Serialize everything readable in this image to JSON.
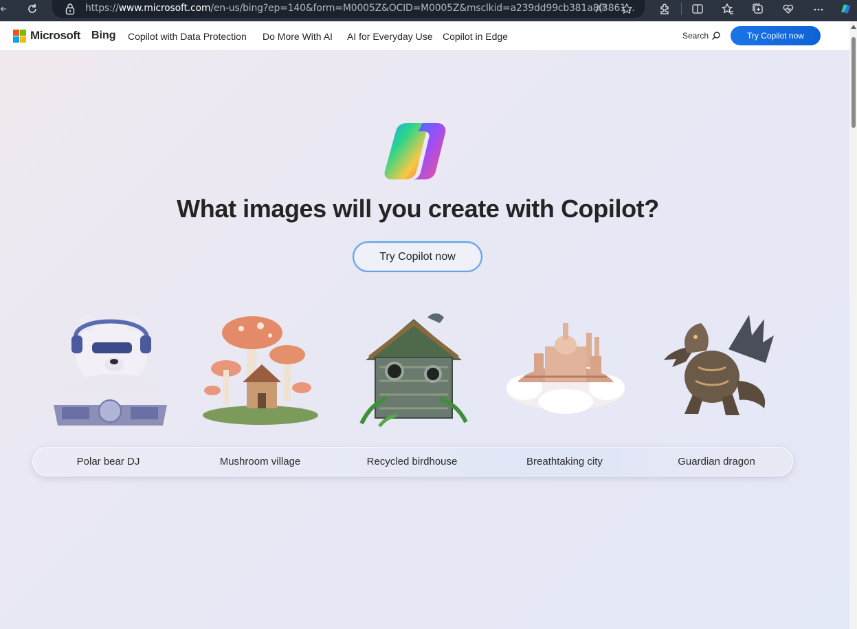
{
  "browser": {
    "url_prefix": "https://",
    "url_domain": "www.microsoft.com",
    "url_rest": "/en-us/bing?ep=140&form=M0005Z&OCID=M0005Z&msclkid=a239dd99cb381a8f3861...",
    "read_aloud_label": "A",
    "icons": [
      "back-icon",
      "refresh-icon",
      "lock-icon",
      "read-aloud-icon",
      "favorite-star-icon",
      "extensions-icon",
      "split-screen-icon",
      "favorites-icon",
      "collections-icon",
      "browser-essentials-icon",
      "more-icon",
      "copilot-icon"
    ]
  },
  "header": {
    "brand": "Microsoft",
    "nav": [
      {
        "label": "Bing"
      },
      {
        "label": "Copilot with Data Protection"
      },
      {
        "label": "Do More With AI"
      },
      {
        "label": "AI for Everyday Use"
      },
      {
        "label": "Copilot in Edge"
      }
    ],
    "search_label": "Search",
    "cta_label": "Try Copilot now"
  },
  "hero": {
    "title": "What images will you create with Copilot?",
    "cta_label": "Try Copilot now"
  },
  "gallery": [
    {
      "label": "Polar bear DJ"
    },
    {
      "label": "Mushroom village"
    },
    {
      "label": "Recycled birdhouse"
    },
    {
      "label": "Breathtaking city"
    },
    {
      "label": "Guardian dragon"
    }
  ],
  "colors": {
    "accent": "#0f6cbd",
    "chrome": "#2b3440",
    "ms_red": "#f25022",
    "ms_green": "#7fba00",
    "ms_blue": "#00a4ef",
    "ms_yellow": "#ffb900"
  }
}
